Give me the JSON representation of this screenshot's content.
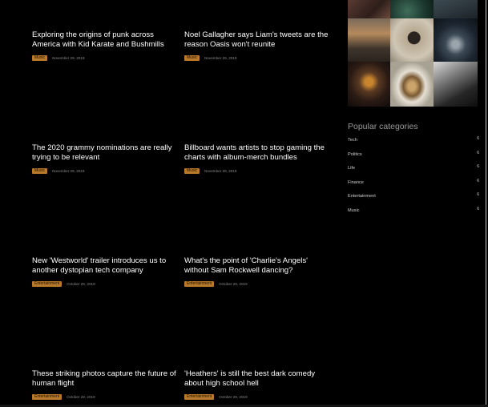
{
  "posts": [
    {
      "title": "Exploring the origins of punk across America with Kid Karate and Bushmills",
      "category": "Music",
      "date": "November 29, 2019"
    },
    {
      "title": "Noel Gallagher says Liam's tweets are the reason Oasis won't reunite",
      "category": "Music",
      "date": "November 29, 2019"
    },
    {
      "title": "The 2020 grammy nominations are really trying to be relevant",
      "category": "Music",
      "date": "November 29, 2019"
    },
    {
      "title": "Billboard wants artists to stop gaming the charts with album-merch bundles",
      "category": "Music",
      "date": "November 29, 2019"
    },
    {
      "title": "New 'Westworld' trailer introduces us to another dystopian tech company",
      "category": "Entertainment",
      "date": "October 29, 2019"
    },
    {
      "title": "What's the point of 'Charlie's Angels' without Sam Rockwell dancing?",
      "category": "Entertainment",
      "date": "October 29, 2019"
    },
    {
      "title": "These striking photos capture the future of human flight",
      "category": "Entertainment",
      "date": "October 29, 2019"
    },
    {
      "title": "'Heathers' is still the best dark comedy about high school hell",
      "category": "Entertainment",
      "date": "October 29, 2019"
    }
  ],
  "sidebar": {
    "gallery_icons": [
      "photo-icon",
      "photo-icon",
      "photo-icon",
      "photo-icon",
      "photo-icon",
      "photo-icon",
      "photo-icon",
      "photo-icon",
      "photo-icon"
    ],
    "popular_title": "Popular categories",
    "categories": [
      {
        "name": "Tech",
        "count": "6"
      },
      {
        "name": "Politics",
        "count": "6"
      },
      {
        "name": "Life",
        "count": "6"
      },
      {
        "name": "Finance",
        "count": "6"
      },
      {
        "name": "Entertainment",
        "count": "6"
      },
      {
        "name": "Music",
        "count": "6"
      }
    ]
  },
  "colors": {
    "badge": "#b8792a",
    "background": "#000000",
    "muted": "#9a9a9a"
  }
}
